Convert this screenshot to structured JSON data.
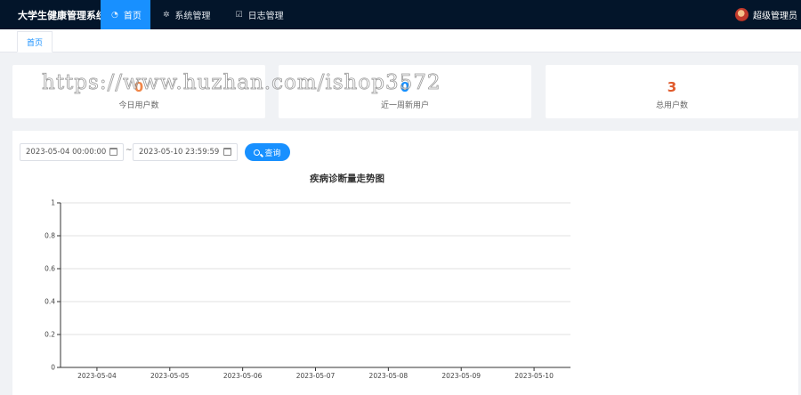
{
  "app": {
    "title": "大学生健康管理系统"
  },
  "nav": {
    "items": [
      {
        "label": "首页",
        "icon": "dashboard-icon",
        "active": true
      },
      {
        "label": "系统管理",
        "icon": "settings-icon",
        "active": false
      },
      {
        "label": "日志管理",
        "icon": "edit-icon",
        "active": false
      }
    ]
  },
  "user": {
    "name": "超级管理员",
    "avatar": "avatar-image"
  },
  "tabs": [
    {
      "label": "首页"
    }
  ],
  "stats": {
    "today": {
      "value": "0",
      "label": "今日用户数",
      "color": "#f0874a"
    },
    "week": {
      "value": "0",
      "label": "近一周新用户",
      "color": "#1890ff"
    },
    "total": {
      "value": "3",
      "label": "总用户数",
      "color": "#e05a2b"
    }
  },
  "filter": {
    "start": "2023-05-04 00:00:00",
    "end": "2023-05-10 23:59:59",
    "separator": "~",
    "query_label": "查询"
  },
  "chart_data": {
    "type": "line",
    "title": "疾病诊断量走势图",
    "categories": [
      "2023-05-04",
      "2023-05-05",
      "2023-05-06",
      "2023-05-07",
      "2023-05-08",
      "2023-05-09",
      "2023-05-10"
    ],
    "series": [],
    "ylim": [
      0,
      1
    ],
    "yticks": [
      0,
      0.2,
      0.4,
      0.6,
      0.8,
      1
    ],
    "grid": true
  },
  "watermark": "https://www.huzhan.com/ishop3572",
  "colors": {
    "nav_bg": "#03152a",
    "accent": "#1890ff"
  }
}
